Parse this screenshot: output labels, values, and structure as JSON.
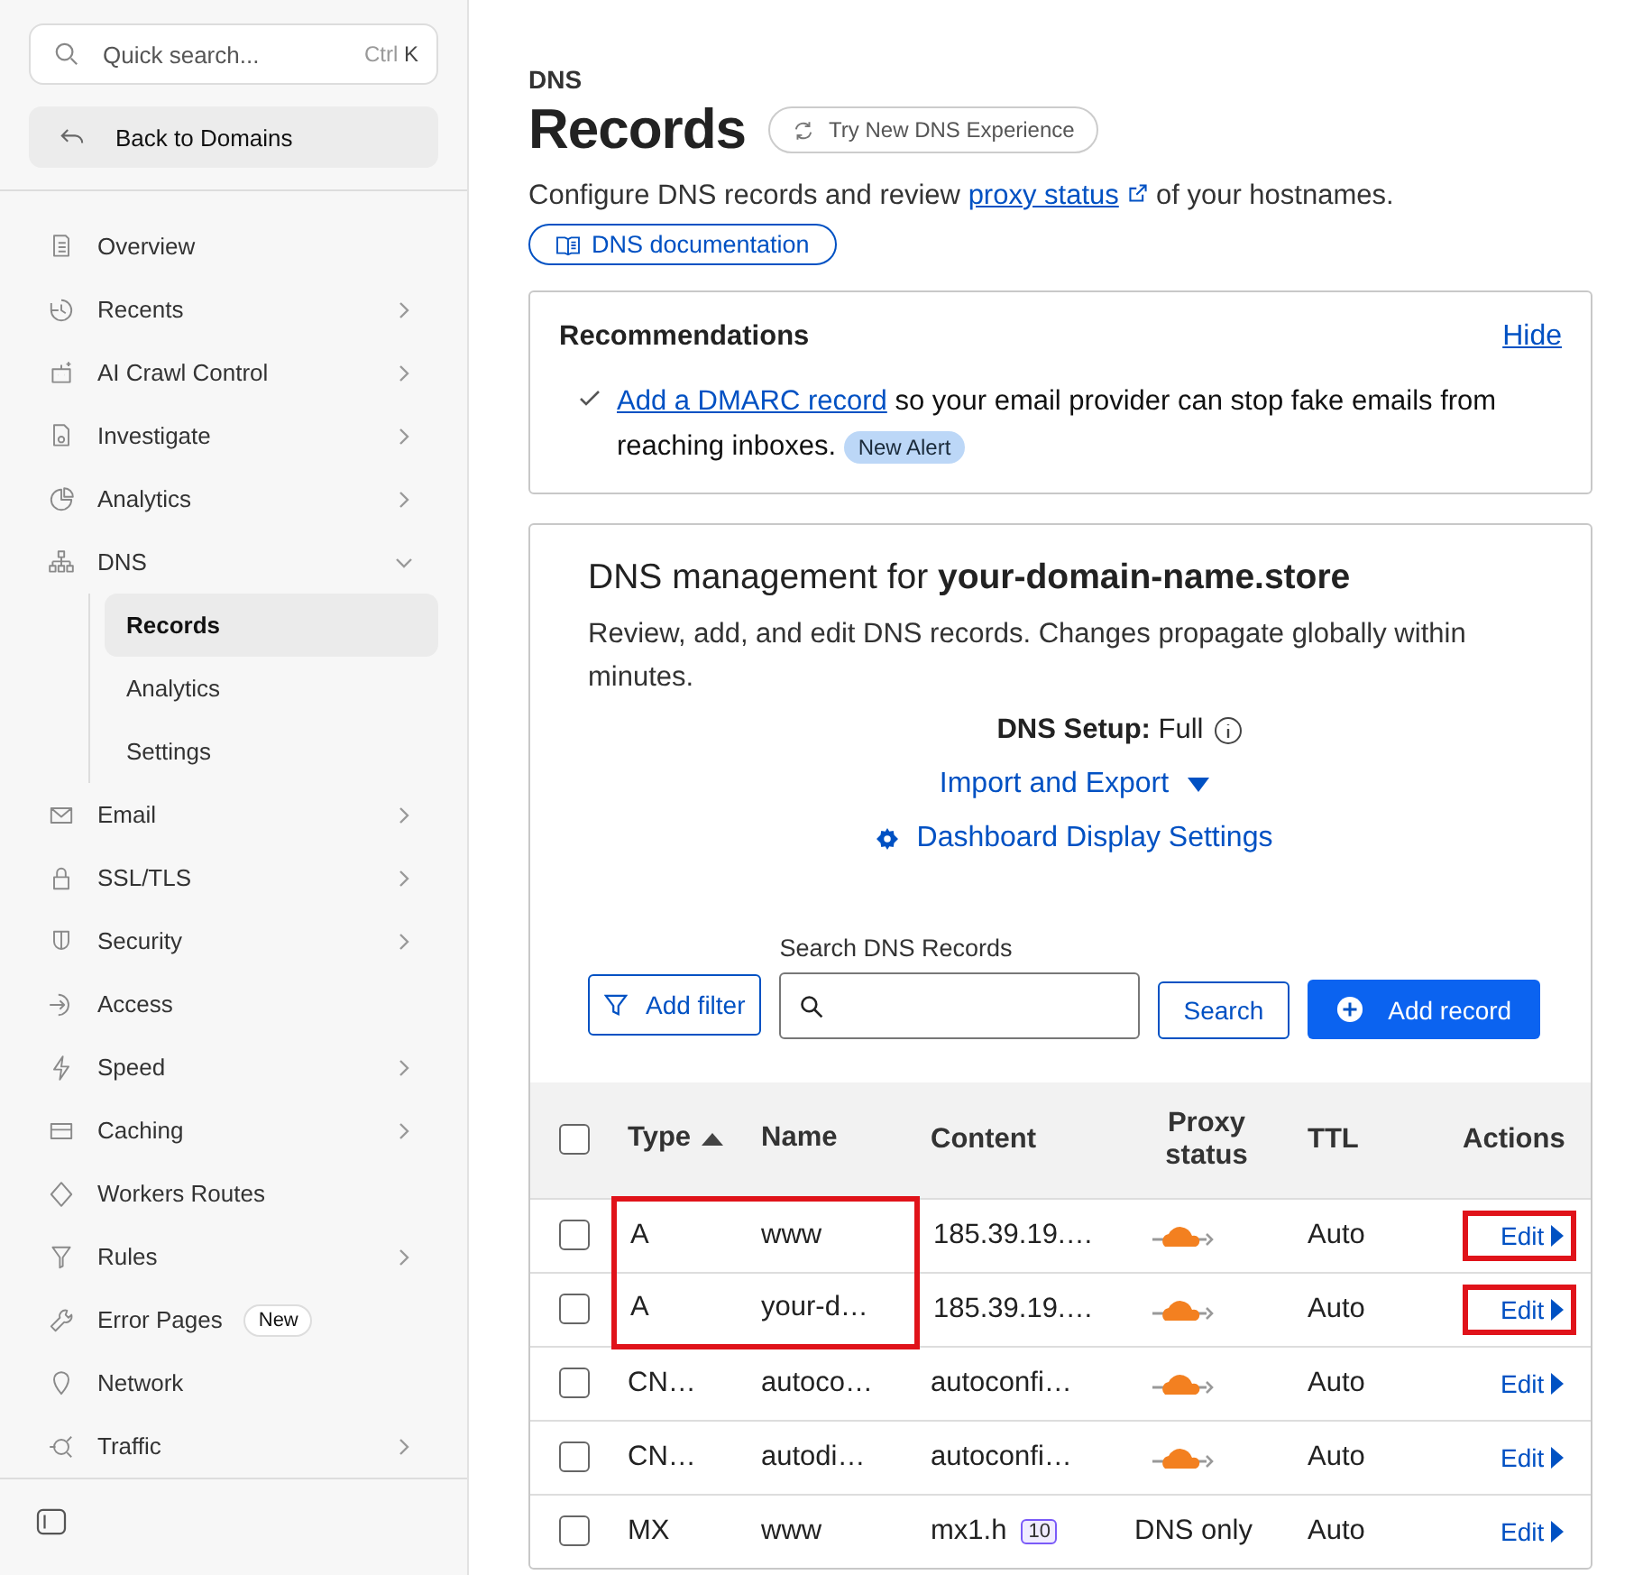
{
  "sidebar": {
    "search": {
      "placeholder": "Quick search...",
      "shortcut_ctrl": "Ctrl",
      "shortcut_key": "K"
    },
    "back_button": "Back to Domains",
    "items": [
      {
        "label": "Overview",
        "kind": "link",
        "selected": false
      },
      {
        "label": "Recents",
        "kind": "group",
        "expanded": false,
        "selected": false
      },
      {
        "label": "AI Crawl Control",
        "kind": "group",
        "expanded": false,
        "selected": false
      },
      {
        "label": "Investigate",
        "kind": "group",
        "expanded": false,
        "selected": false
      },
      {
        "label": "Analytics",
        "kind": "group",
        "expanded": false,
        "selected": false
      },
      {
        "label": "DNS",
        "kind": "group",
        "expanded": true,
        "selected": false,
        "children": [
          {
            "label": "Records",
            "selected": true
          },
          {
            "label": "Analytics",
            "selected": false
          },
          {
            "label": "Settings",
            "selected": false
          }
        ]
      },
      {
        "label": "Email",
        "kind": "group",
        "expanded": false,
        "selected": false
      },
      {
        "label": "SSL/TLS",
        "kind": "group",
        "expanded": false,
        "selected": false
      },
      {
        "label": "Security",
        "kind": "group",
        "expanded": false,
        "selected": false
      },
      {
        "label": "Access",
        "kind": "link",
        "selected": false
      },
      {
        "label": "Speed",
        "kind": "group",
        "expanded": false,
        "selected": false
      },
      {
        "label": "Caching",
        "kind": "group",
        "expanded": false,
        "selected": false
      },
      {
        "label": "Workers Routes",
        "kind": "link",
        "selected": false
      },
      {
        "label": "Rules",
        "kind": "group",
        "expanded": false,
        "selected": false
      },
      {
        "label": "Error Pages",
        "kind": "link",
        "selected": false,
        "badge": "New"
      },
      {
        "label": "Network",
        "kind": "link",
        "selected": false
      },
      {
        "label": "Traffic",
        "kind": "group",
        "expanded": false,
        "selected": false
      }
    ]
  },
  "header": {
    "eyebrow": "DNS",
    "title": "Records",
    "try_button": "Try New DNS Experience",
    "description_before": "Configure DNS records and review",
    "description_link": "proxy status",
    "description_after": "of your hostnames.",
    "docs_button": "DNS documentation"
  },
  "recommendations": {
    "title": "Recommendations",
    "hide_link": "Hide",
    "items": [
      {
        "link": "Add a DMARC record",
        "text": "so your email provider can stop fake emails from reaching inboxes.",
        "badge": "New Alert"
      }
    ]
  },
  "management": {
    "title_before": "DNS management for",
    "domain": "your-domain-name.store",
    "description": "Review, add, and edit DNS records. Changes propagate globally within minutes.",
    "setup_label": "DNS Setup:",
    "setup_value": "Full",
    "import_export": "Import and Export",
    "display_settings": "Dashboard Display Settings",
    "add_filter": "Add filter",
    "search_label": "Search DNS Records",
    "search_button": "Search",
    "add_record": "Add record"
  },
  "table": {
    "columns": [
      "Type",
      "Name",
      "Content",
      "Proxy status",
      "TTL",
      "Actions"
    ],
    "select_all_checked": false,
    "rows": [
      {
        "type": "A",
        "name": "www",
        "content": "185.39.19.…",
        "kind": "proxied",
        "ttl": "Auto",
        "action": "Edit",
        "checked": false,
        "marked": true,
        "edit_marked": true
      },
      {
        "type": "A",
        "name": "your-d…",
        "content": "185.39.19.…",
        "kind": "proxied",
        "ttl": "Auto",
        "action": "Edit",
        "checked": false,
        "marked": true,
        "edit_marked": true
      },
      {
        "type": "CN…",
        "name": "autoco…",
        "content": "autoconfi…",
        "kind": "proxied",
        "ttl": "Auto",
        "action": "Edit",
        "checked": false,
        "marked": false,
        "edit_marked": false
      },
      {
        "type": "CN…",
        "name": "autodi…",
        "content": "autoconfi…",
        "kind": "proxied",
        "ttl": "Auto",
        "action": "Edit",
        "checked": false,
        "marked": false,
        "edit_marked": false
      },
      {
        "type": "MX",
        "name": "www",
        "content": "mx1.h",
        "priority": "10",
        "kind": "dns_only",
        "proxy_text": "DNS only",
        "ttl": "Auto",
        "action": "Edit",
        "checked": false,
        "marked": false,
        "edit_marked": false
      }
    ]
  }
}
